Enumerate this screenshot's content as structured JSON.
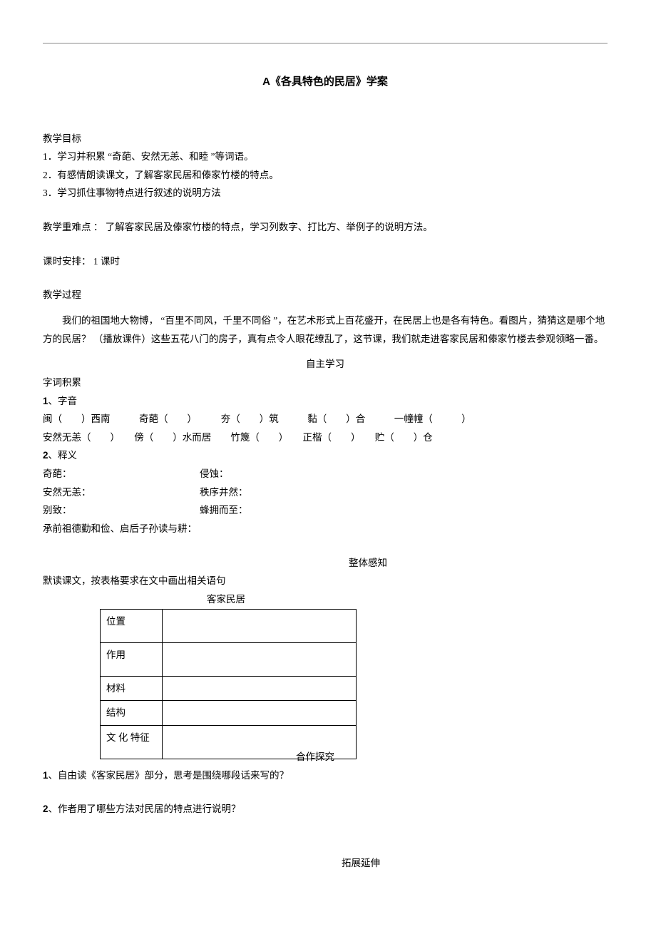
{
  "title_prefix": "A",
  "title_main": "《各具特色的民居》学案",
  "sec_objectives": "教学目标",
  "obj1": "1．学习并积累 “奇葩、安然无恙、和睦 ”等词语。",
  "obj2": "2．有感情朗读课文，了解客家民居和傣家竹楼的特点。",
  "obj3": "3．学习抓住事物特点进行叙述的说明方法",
  "sec_diff": "教学重难点 ： 了解客家民居及傣家竹楼的特点，学习列数字、打比方、举例子的说明方法。",
  "sec_hours": "课时安排： 1 课时",
  "sec_process": "教学过程",
  "intro": "我们的祖国地大物博， “百里不同风，千里不同俗 ”，在艺术形式上百花盛开，在民居上也是各有特色。看图片，猜猜这是哪个地方的民居？ （播放课件）这些五花八门的房子，真有点令人眼花缭乱了，这节课，我们就走进客家民居和傣家竹楼去参观领略一番。",
  "sec_self": "自主学习",
  "vocab_label": "字词积累",
  "pron_num": "1",
  "pron_label": "、字音",
  "pron_line1": "闽（　　）西南　　　奇葩（　　）　　　夯（　　）筑　　　黏（　　）合　　　一幢幢（　　　）",
  "pron_line2": "安然无恙（　　）　　傍（　　）水而居　　竹篾（　　）　　正楷（　　）　　贮（　　）仓",
  "def_num": "2",
  "def_label": "、释义",
  "def1l": "奇葩：",
  "def1r": "侵蚀：",
  "def2l": "安然无恙：",
  "def2r": "秩序井然：",
  "def3l": "别致：",
  "def3r": "蜂拥而至：",
  "def4": "承前祖德勤和俭、启后子孙读与耕：",
  "sec_whole": "整体感知",
  "whole_instr": "默读课文，按表格要求在文中画出相关语句",
  "table_title": "客家民居",
  "row1": "位置",
  "row2": "作用",
  "row3": "材料",
  "row4": "结构",
  "row5": "文 化 特征",
  "sec_coop": "合作探究",
  "coop_num1": "1",
  "coop_q1": "、自由读《客家民居》部分，思考是围绕哪段话来写的？",
  "coop_num2": "2",
  "coop_q2": "、作者用了哪些方法对民居的特点进行说明？",
  "sec_ext": "拓展延伸"
}
